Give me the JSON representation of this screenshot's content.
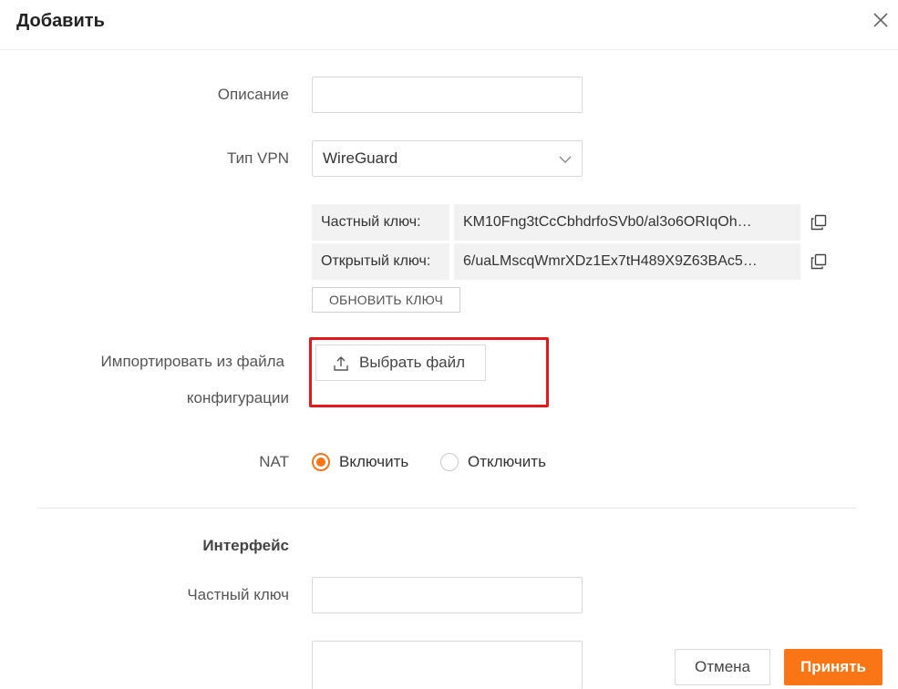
{
  "dialog": {
    "title": "Добавить",
    "close_icon": "close-icon"
  },
  "form": {
    "description_label": "Описание",
    "description_value": "",
    "vpn_type_label": "Тип VPN",
    "vpn_type_value": "WireGuard",
    "private_key_label": "Частный ключ:",
    "private_key_value": "KM10Fng3tCcCbhdrfoSVb0/al3o6ORIqOh…",
    "public_key_label": "Открытый ключ:",
    "public_key_value": "6/uaLMscqWmrXDz1Ex7tH489X9Z63BAc5…",
    "refresh_key_label": "ОБНОВИТЬ КЛЮЧ",
    "import_label_line1": "Импортировать из файла",
    "import_label_line2": "конфигурации",
    "choose_file_label": "Выбрать файл",
    "nat_label": "NAT",
    "nat_enable_label": "Включить",
    "nat_disable_label": "Отключить",
    "nat_selected": "enable"
  },
  "interface_section": {
    "title": "Интерфейс",
    "private_key_label": "Частный ключ",
    "private_key_value": ""
  },
  "footer": {
    "cancel_label": "Отмена",
    "accept_label": "Принять"
  },
  "colors": {
    "accent": "#f97516",
    "highlight": "#e8151b"
  }
}
